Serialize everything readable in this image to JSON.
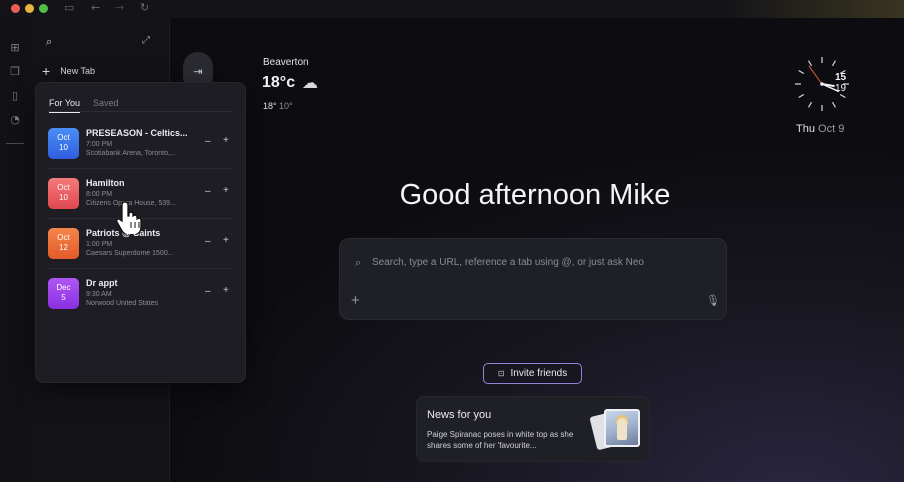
{
  "sidebar": {
    "new_tab_label": "New Tab"
  },
  "panel": {
    "tabs": [
      {
        "label": "For You",
        "active": true
      },
      {
        "label": "Saved",
        "active": false
      }
    ],
    "events": [
      {
        "month": "Oct",
        "day": "10",
        "title": "PRESEASON - Celtics...",
        "time": "7:00 PM",
        "location": "Scotiabank Arena, Toronto,...",
        "color_top": "#4a8ef5",
        "color_bottom": "#2f5ee0"
      },
      {
        "month": "Oct",
        "day": "10",
        "title": "Hamilton",
        "time": "8:00 PM",
        "location": "Citizens Opera House, 539...",
        "color_top": "#f47a7a",
        "color_bottom": "#e0474f"
      },
      {
        "month": "Oct",
        "day": "12",
        "title": "Patriots @ Saints",
        "time": "1:00 PM",
        "location": "Caesars Superdome 1500...",
        "color_top": "#f5864a",
        "color_bottom": "#e35a2a"
      },
      {
        "month": "Dec",
        "day": "5",
        "title": "Dr appt",
        "time": "9:30 AM",
        "location": "Norwood United States",
        "color_top": "#b057f5",
        "color_bottom": "#8a2fe0"
      }
    ],
    "minus_glyph": "–",
    "plus_glyph": "+"
  },
  "weather": {
    "city": "Beaverton",
    "temp": "18°c",
    "high": "18°",
    "low": "10°",
    "icon": "cloud-icon"
  },
  "clock": {
    "hour_label": "15",
    "minute_label": "19",
    "hour": 15,
    "minute": 19,
    "second": 54
  },
  "date": {
    "weekday": "Thu",
    "month_day": "Oct 9"
  },
  "greeting": "Good afternoon Mike",
  "search": {
    "placeholder": "Search, type a URL, reference a tab using @, or just ask Neo"
  },
  "invite_label": "Invite friends",
  "news": {
    "heading": "News for you",
    "text": "Paige Spiranac poses in white top as she shares some of her 'favourite..."
  },
  "colors": {
    "accent_border": "#8a86d8",
    "clock_second_hand": "#e05a3a"
  }
}
